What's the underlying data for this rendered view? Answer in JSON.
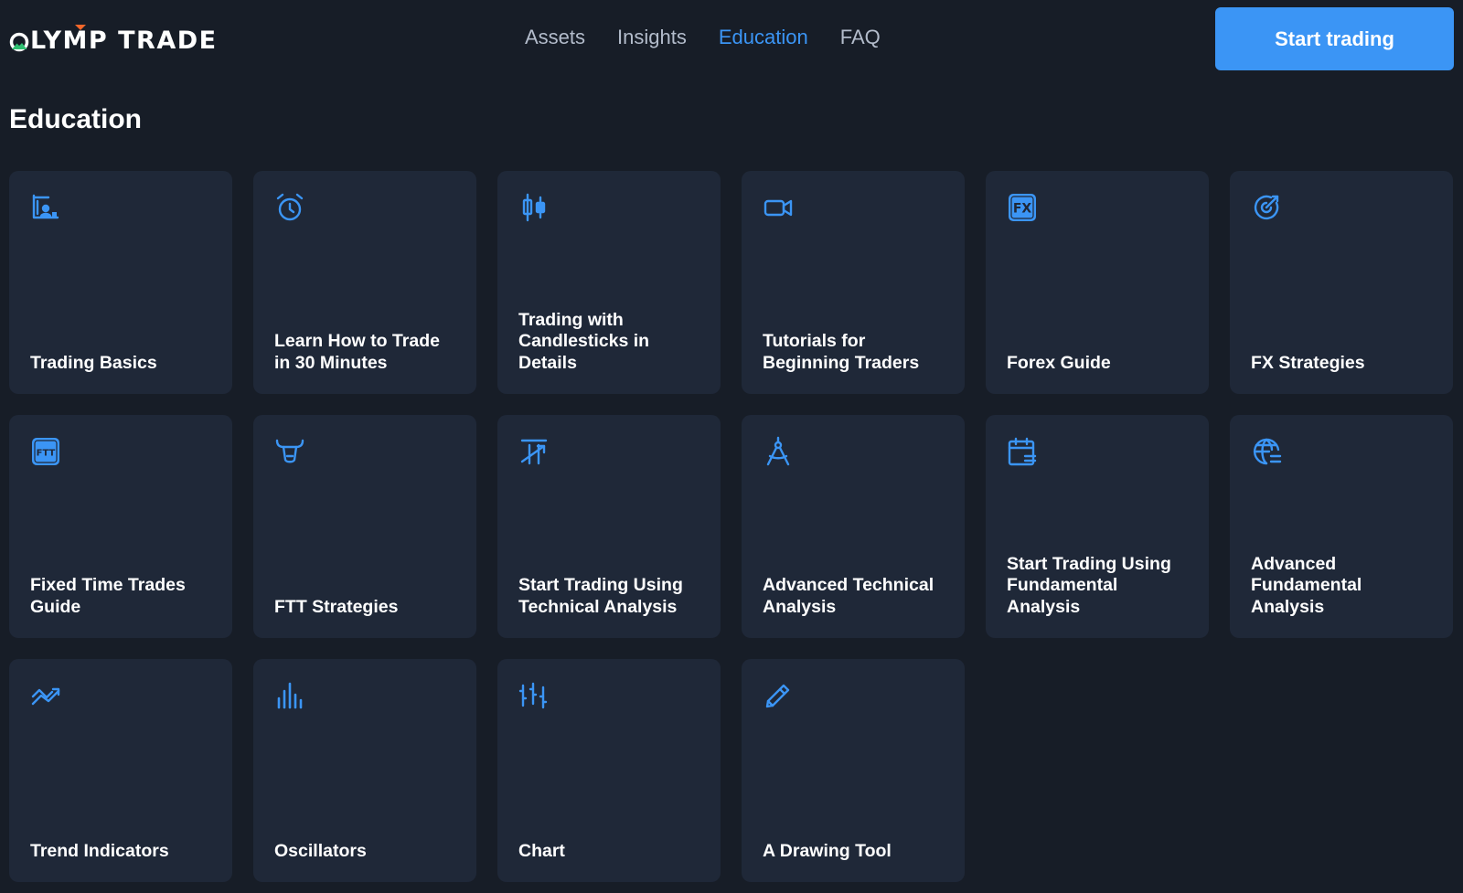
{
  "brand": {
    "name": "LYMP TRADE",
    "accent": "#3b95f5",
    "logo_green": "#2fbf71",
    "logo_orange": "#f5672a"
  },
  "nav": {
    "items": [
      {
        "label": "Assets",
        "active": false
      },
      {
        "label": "Insights",
        "active": false
      },
      {
        "label": "Education",
        "active": true
      },
      {
        "label": "FAQ",
        "active": false
      }
    ]
  },
  "header": {
    "cta_label": "Start trading"
  },
  "page": {
    "title": "Education"
  },
  "cards": [
    {
      "title": "Trading Basics",
      "icon": "chart-person-icon"
    },
    {
      "title": "Learn How to Trade in 30 Minutes",
      "icon": "alarm-clock-icon"
    },
    {
      "title": "Trading with Candlesticks in Details",
      "icon": "candlestick-icon"
    },
    {
      "title": "Tutorials for Beginning Traders",
      "icon": "video-camera-icon"
    },
    {
      "title": "Forex Guide",
      "icon": "fx-badge-icon",
      "badge": "FX"
    },
    {
      "title": "FX Strategies",
      "icon": "target-icon"
    },
    {
      "title": "Fixed Time Trades Guide",
      "icon": "ftt-badge-icon",
      "badge": "FTT"
    },
    {
      "title": "FTT Strategies",
      "icon": "bull-icon"
    },
    {
      "title": "Start Trading Using Technical Analysis",
      "icon": "trend-arrow-icon"
    },
    {
      "title": "Advanced Technical Analysis",
      "icon": "compass-icon"
    },
    {
      "title": "Start Trading Using Fundamental Analysis",
      "icon": "calendar-icon"
    },
    {
      "title": "Advanced Fundamental Analysis",
      "icon": "globe-icon"
    },
    {
      "title": "Trend Indicators",
      "icon": "trend-line-icon"
    },
    {
      "title": "Oscillators",
      "icon": "bar-chart-icon"
    },
    {
      "title": "Chart",
      "icon": "ohlc-chart-icon"
    },
    {
      "title": "A Drawing Tool",
      "icon": "pencil-icon"
    }
  ]
}
